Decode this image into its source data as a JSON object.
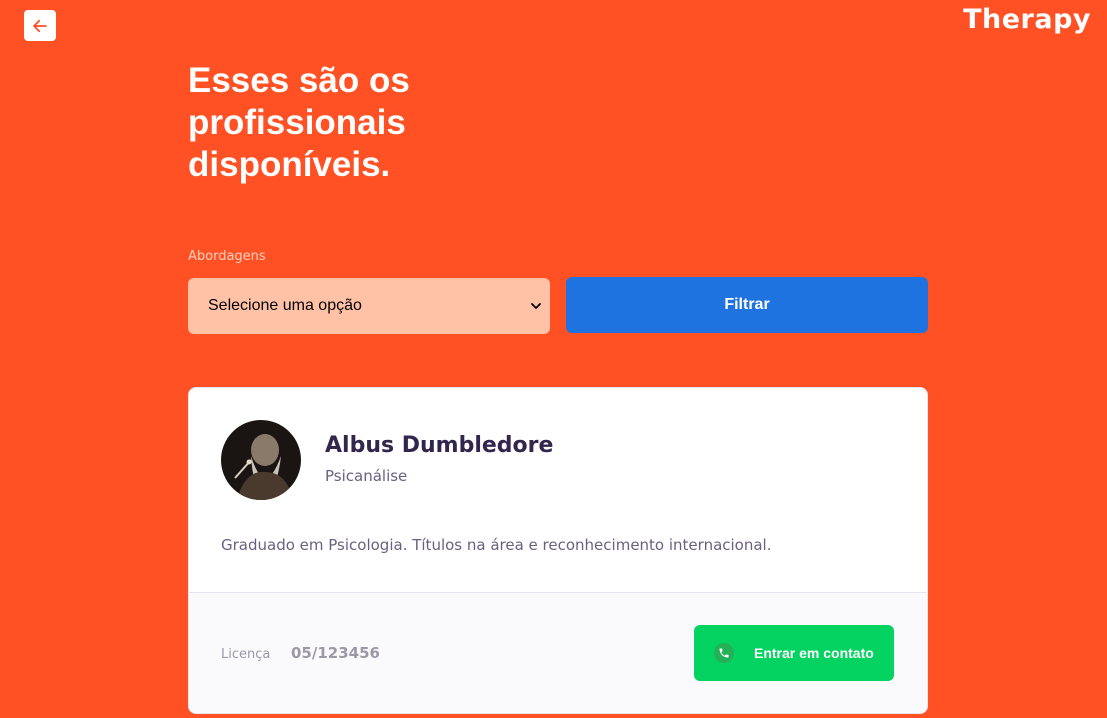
{
  "header": {
    "logo": "Therapy"
  },
  "main": {
    "title": "Esses são os profissionais disponíveis."
  },
  "filter": {
    "label": "Abordagens",
    "selected_option": "Selecione uma opção",
    "button_label": "Filtrar"
  },
  "professional": {
    "name": "Albus Dumbledore",
    "approach": "Psicanálise",
    "bio": "Graduado em Psicologia. Títulos na área e reconhecimento internacional.",
    "license_label": "Licença",
    "license_number": "05/123456",
    "contact_label": "Entrar em contato"
  },
  "icons": {
    "back": "arrow-left-icon",
    "select": "chevron-down-icon",
    "contact": "whatsapp-icon"
  },
  "colors": {
    "background": "#FF5124",
    "filter_button": "#1F73E0",
    "contact_button": "#04D361",
    "select_background": "#FFC2A6"
  }
}
